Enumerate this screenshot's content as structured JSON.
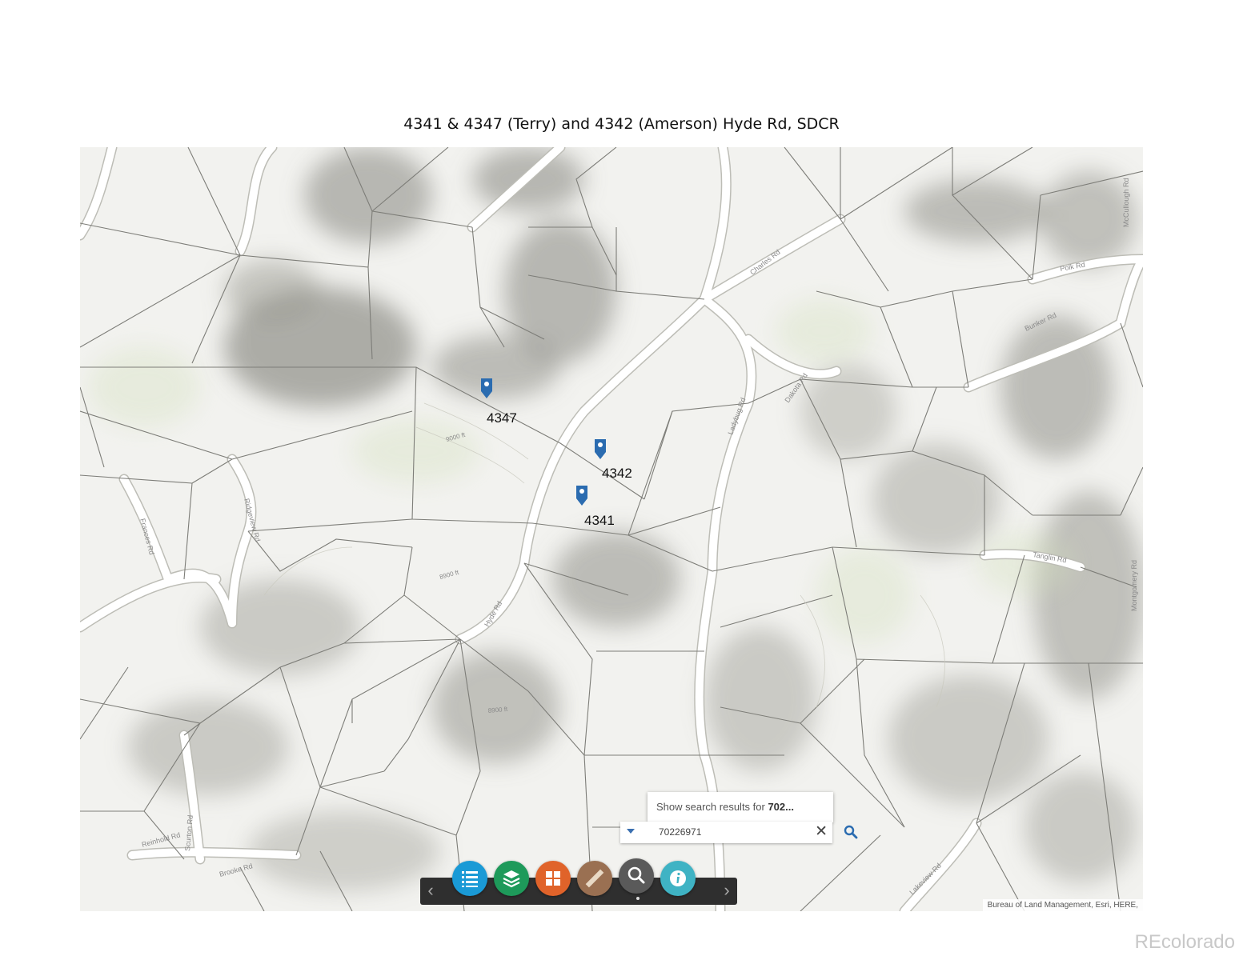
{
  "title": "4341 & 4347 (Terry) and 4342 (Amerson)  Hyde Rd, SDCR",
  "markers": [
    {
      "label": "4347"
    },
    {
      "label": "4342"
    },
    {
      "label": "4341"
    }
  ],
  "marker_color": "#2b6cb0",
  "road_labels": [
    "Charles Rd",
    "Hyde Rd",
    "Ladybug Rd",
    "Dakota Rd",
    "Bunker Rd",
    "Ridgeview Rd",
    "Frances Rd",
    "Polk Rd",
    "Lakeview Rd",
    "Reinhold Rd",
    "Scurton Rd",
    "Brooke Rd",
    "Tanglin Rd",
    "McCullough Rd",
    "Montgomery Rd",
    "Hyde Rd"
  ],
  "contour_labels": [
    "9000 ft",
    "8900 ft",
    "8900 ft",
    "9000 ft"
  ],
  "search": {
    "popup_prefix": "Show search results for ",
    "popup_query": "702...",
    "value": "70226971",
    "clear_symbol": "✕"
  },
  "toolbar": {
    "prev_symbol": "‹",
    "next_symbol": "›",
    "buttons": [
      {
        "name": "list",
        "icon": "list-icon",
        "color": "#1a9ad6"
      },
      {
        "name": "layers",
        "icon": "layers-icon",
        "color": "#1e9a5a"
      },
      {
        "name": "basemap",
        "icon": "grid-icon",
        "color": "#e0632a"
      },
      {
        "name": "measure",
        "icon": "ruler-icon",
        "color": "#9a7052"
      },
      {
        "name": "search",
        "icon": "magnifier-icon",
        "color": "#5a5a5a"
      },
      {
        "name": "info",
        "icon": "info-icon",
        "color": "#3fb3c4"
      }
    ]
  },
  "attribution": "Bureau of Land Management, Esri, HERE,",
  "watermark": "REcolorado"
}
